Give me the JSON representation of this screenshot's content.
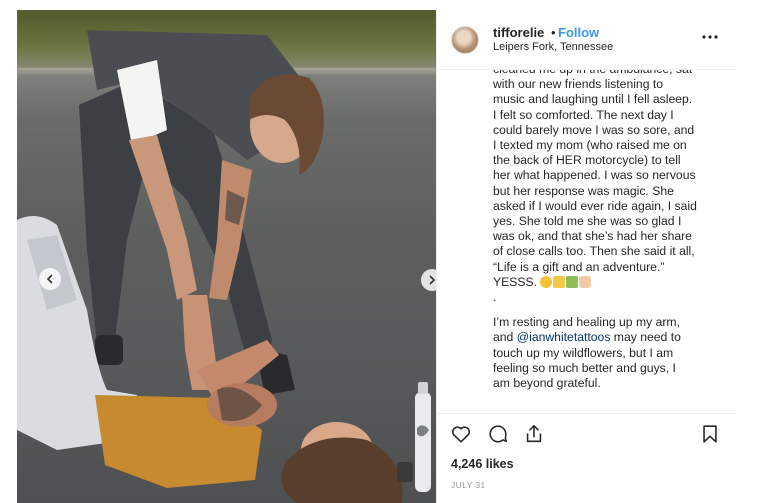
{
  "post": {
    "username": "tifforelie",
    "separator": "•",
    "follow_label": "Follow",
    "location": "Leipers Fork, Tennessee",
    "more_icon": "ellipsis-icon",
    "caption_lines": [
      "cleaned me up in the ambulance, sat",
      "with our new friends listening to",
      "music and laughing until I fell asleep.",
      "I felt so comforted. The next day I",
      "could barely move I was so sore, and",
      "I texted my mom (who raised me on",
      "the back of HER motorcycle) to tell",
      "her what happened. I was so nervous",
      "but her response was magic. She",
      "asked if I would ever ride again, I said",
      "yes. She told me she was so glad I",
      "was ok, and that she’s had her share",
      "of close calls too. Then she said it all,",
      "“Life is a gift and an adventure.”"
    ],
    "caption_yess": "YESSS.",
    "caption_dot": ".",
    "caption_para2_line1": "I’m resting and healing up my arm,",
    "caption_para2_line2_pre": "and ",
    "caption_mention": "@ianwhitetattoos",
    "caption_para2_line2_post": " may need to",
    "caption_para2_rest": [
      "touch up my wildflowers, but I am",
      "feeling so much better and guys, I",
      "am beyond grateful."
    ],
    "likes": "4,246 likes",
    "date": "JULY 31"
  },
  "icons": {
    "like": "heart-icon",
    "comment": "comment-icon",
    "share": "share-icon",
    "save": "bookmark-icon",
    "prev": "chevron-left-icon",
    "next": "chevron-right-icon"
  },
  "colors": {
    "follow": "#3897f0",
    "mention": "#003569",
    "text": "#262626",
    "muted": "#999999",
    "border": "#efefef"
  }
}
